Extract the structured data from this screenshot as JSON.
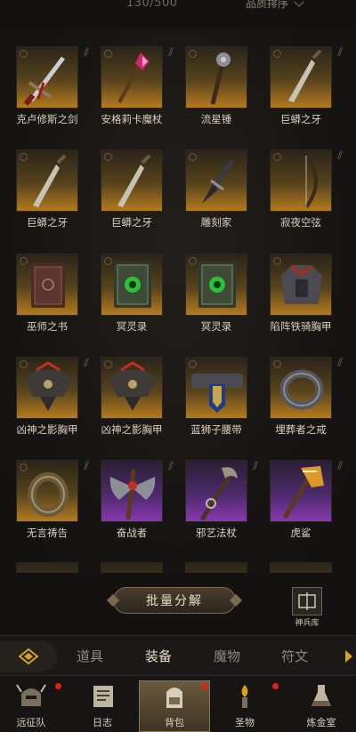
{
  "header": {
    "capacity": "130/500",
    "sort_label": "品质排序"
  },
  "items": [
    {
      "name": "克卢修斯之剑",
      "rarity": "gold",
      "icon": "greatsword-icon"
    },
    {
      "name": "安格莉卡魔杖",
      "rarity": "gold",
      "icon": "magic-wand-icon"
    },
    {
      "name": "流星锤",
      "rarity": "gold",
      "icon": "flail-icon"
    },
    {
      "name": "巨蟒之牙",
      "rarity": "gold",
      "icon": "dagger-icon"
    },
    {
      "name": "巨蟒之牙",
      "rarity": "gold",
      "icon": "dagger-icon"
    },
    {
      "name": "巨蟒之牙",
      "rarity": "gold",
      "icon": "dagger-icon"
    },
    {
      "name": "雕刻家",
      "rarity": "gold",
      "icon": "dagger-icon"
    },
    {
      "name": "寂夜空弦",
      "rarity": "gold",
      "icon": "bow-icon"
    },
    {
      "name": "巫师之书",
      "rarity": "gold",
      "icon": "book-icon"
    },
    {
      "name": "冥灵录",
      "rarity": "gold",
      "icon": "book-icon"
    },
    {
      "name": "冥灵录",
      "rarity": "gold",
      "icon": "book-icon"
    },
    {
      "name": "陷阵铁骑胸甲",
      "rarity": "gold",
      "icon": "chest-armor-icon"
    },
    {
      "name": "凶神之影胸甲",
      "rarity": "gold",
      "icon": "chest-armor-icon"
    },
    {
      "name": "凶神之影胸甲",
      "rarity": "gold",
      "icon": "chest-armor-icon"
    },
    {
      "name": "蓝狮子腰带",
      "rarity": "gold",
      "icon": "belt-icon"
    },
    {
      "name": "埋葬者之戒",
      "rarity": "gold",
      "icon": "ring-icon"
    },
    {
      "name": "无言祷告",
      "rarity": "gold",
      "icon": "ring-icon"
    },
    {
      "name": "奋战者",
      "rarity": "purple",
      "icon": "axe-icon"
    },
    {
      "name": "邪艺法杖",
      "rarity": "purple",
      "icon": "staff-icon"
    },
    {
      "name": "虎鲨",
      "rarity": "purple",
      "icon": "axe-icon"
    }
  ],
  "actions": {
    "batch_dismantle": "批量分解",
    "armory": "神兵库"
  },
  "tabs": [
    {
      "label": "道具",
      "active": false
    },
    {
      "label": "装备",
      "active": true
    },
    {
      "label": "魔物",
      "active": false
    },
    {
      "label": "符文",
      "active": false
    }
  ],
  "nav": [
    {
      "label": "远征队",
      "icon": "helmet-icon",
      "badge": true
    },
    {
      "label": "日志",
      "icon": "journal-icon",
      "badge": false
    },
    {
      "label": "背包",
      "icon": "backpack-icon",
      "badge": true,
      "active": true
    },
    {
      "label": "圣物",
      "icon": "torch-icon",
      "badge": true
    },
    {
      "label": "炼金室",
      "icon": "flask-icon",
      "badge": false
    }
  ],
  "colors": {
    "gold_tile": "#b47a1f",
    "purple_tile": "#8838b0",
    "accent": "#d6a11f",
    "badge": "#e0211a"
  }
}
